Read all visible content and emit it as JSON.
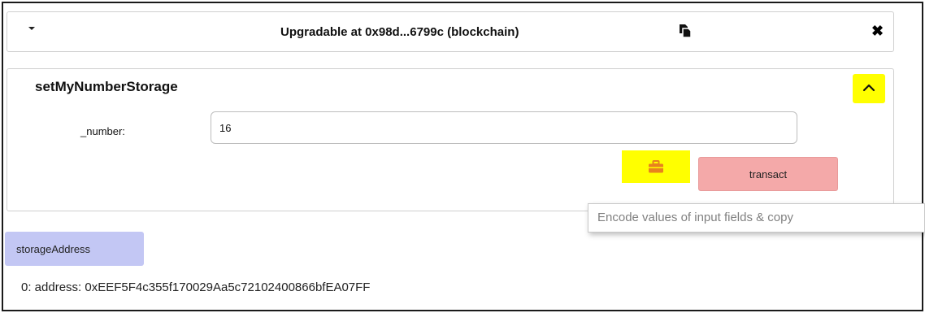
{
  "header": {
    "title": "Upgradable at 0x98d...6799c (blockchain)",
    "caret_icon": "caret-down-icon",
    "copy_icon": "copy-icon",
    "close_icon": "close-icon"
  },
  "function": {
    "name": "setMyNumberStorage",
    "collapse_icon": "chevron-up-icon",
    "param_label": "_number:",
    "param_value": "16",
    "encode_icon": "briefcase-icon",
    "transact_label": "transact"
  },
  "tooltip": {
    "text": "Encode values of input fields & copy"
  },
  "storage": {
    "button_label": "storageAddress",
    "result": "0: address: 0xEEF5F4c355f170029Aa5c72102400866bfEA07FF"
  },
  "colors": {
    "highlight": "#ffff00",
    "transact_button": "#f4a9a9",
    "call_button": "#c3c7f4",
    "encode_icon": "#e8821e"
  }
}
